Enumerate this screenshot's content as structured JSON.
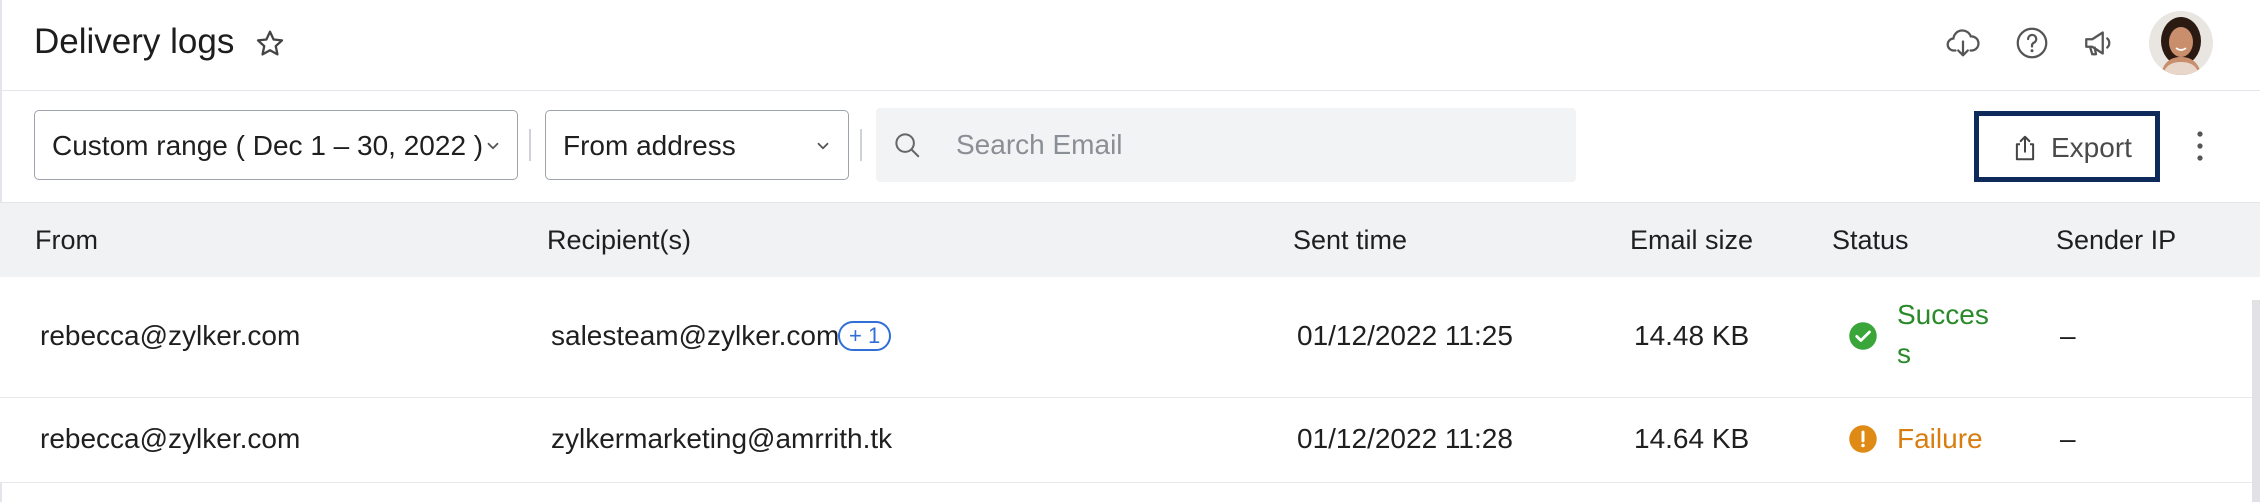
{
  "header": {
    "title": "Delivery logs",
    "icons": [
      "star-icon",
      "cloud-download-icon",
      "help-icon",
      "announcement-icon",
      "avatar"
    ]
  },
  "toolbar": {
    "date_range": "Custom range ( Dec 1 – 30, 2022 )",
    "from_address": "From address",
    "search_placeholder": "Search Email",
    "export_label": "Export"
  },
  "table": {
    "columns": [
      "From",
      "Recipient(s)",
      "Sent time",
      "Email size",
      "Status",
      "Sender IP"
    ],
    "rows": [
      {
        "from": "rebecca@zylker.com",
        "recipient": "salesteam@zylker.com",
        "extra_recipients": "+ 1",
        "sent_time": "01/12/2022 11:25",
        "size": "14.48 KB",
        "status_line1": "Succes",
        "status_line2": "s",
        "sender_ip": "–"
      },
      {
        "from": "rebecca@zylker.com",
        "recipient": "zylkermarketing@amrrith.tk",
        "sent_time": "01/12/2022 11:28",
        "size": "14.64 KB",
        "status": "Failure",
        "sender_ip": "–"
      }
    ]
  },
  "colors": {
    "accent_border": "#0d2a5a",
    "success": "#2a8a2a",
    "failure": "#d97d10",
    "badge": "#2f6fd6"
  }
}
